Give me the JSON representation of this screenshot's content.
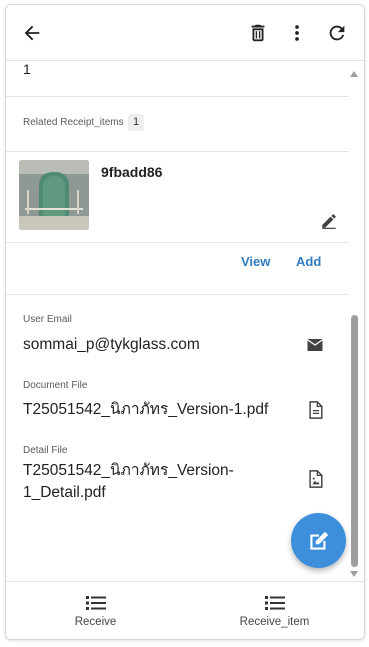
{
  "toolbar": {
    "back_icon": "arrow-left-icon",
    "delete_icon": "trash-icon",
    "more_icon": "more-vert-icon",
    "refresh_icon": "refresh-icon"
  },
  "top_cut_value": "1",
  "related": {
    "label": "Related Receipt_items",
    "count": "1",
    "item_title": "9fbadd86",
    "view_label": "View",
    "add_label": "Add"
  },
  "fields": {
    "email_label": "User Email",
    "email_value": "sommai_p@tykglass.com",
    "doc_label": "Document File",
    "doc_value": "T25051542_นิภาภัทร_Version-1.pdf",
    "detail_label": "Detail File",
    "detail_value_line1": "T25051542_นิภาภัทร_Version-",
    "detail_value_line2": "1_Detail.pdf"
  },
  "bottom_nav": {
    "items": [
      {
        "label": "Receive",
        "icon": "list-icon"
      },
      {
        "label": "Receive_item",
        "icon": "list-icon"
      }
    ]
  },
  "colors": {
    "accent": "#3d8fdc",
    "link": "#2f7cc1"
  }
}
